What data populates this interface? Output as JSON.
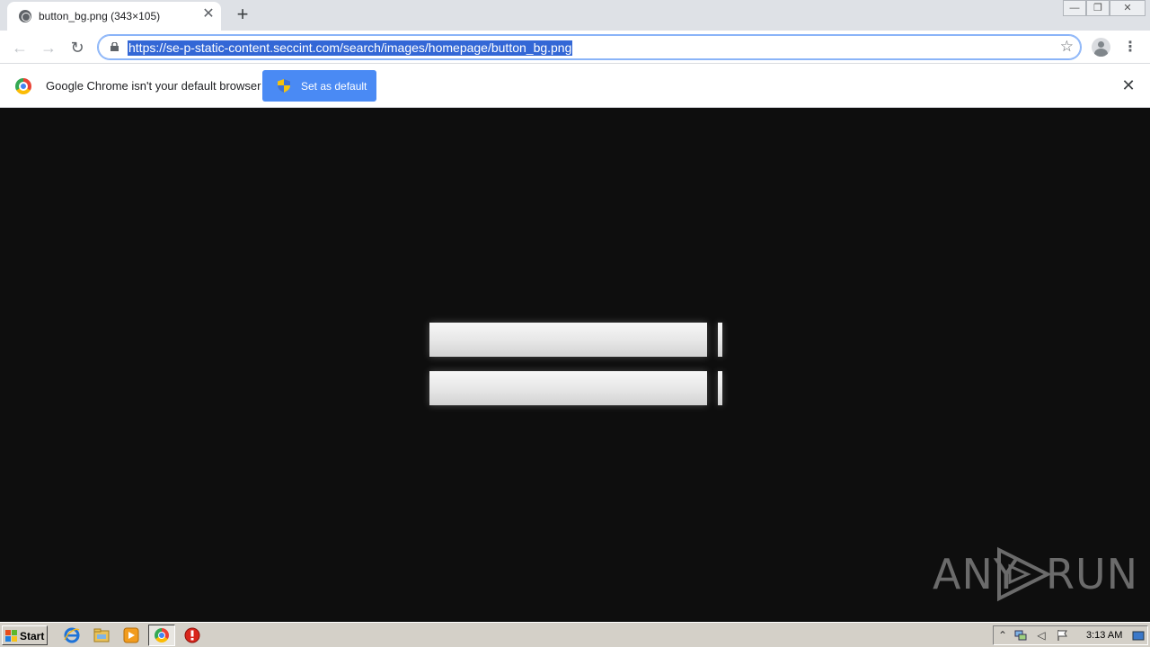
{
  "tab": {
    "title": "button_bg.png (343×105)",
    "close_glyph": "✕"
  },
  "new_tab_glyph": "+",
  "window_controls": {
    "minimize": "—",
    "restore": "❐",
    "close": "✕"
  },
  "toolbar": {
    "back_glyph": "←",
    "forward_glyph": "→",
    "reload_glyph": "↻",
    "url": "https://se-p-static-content.seccint.com/search/images/homepage/button_bg.png",
    "bookmark_glyph": "☆",
    "menu_glyph": "⋮"
  },
  "infobar": {
    "message": "Google Chrome isn't your default browser",
    "button_label": "Set as default",
    "close_glyph": "✕"
  },
  "watermark": {
    "left": "ANY",
    "right": "RUN"
  },
  "taskbar": {
    "start_label": "Start",
    "clock": "3:13 AM",
    "icons": [
      "ie-icon",
      "explorer-folder-icon",
      "media-player-icon",
      "chrome-icon",
      "stop-icon"
    ]
  },
  "colors": {
    "accent_blue": "#4a8af4",
    "url_highlight": "#3367d6",
    "viewport_bg": "#0e0e0e"
  }
}
